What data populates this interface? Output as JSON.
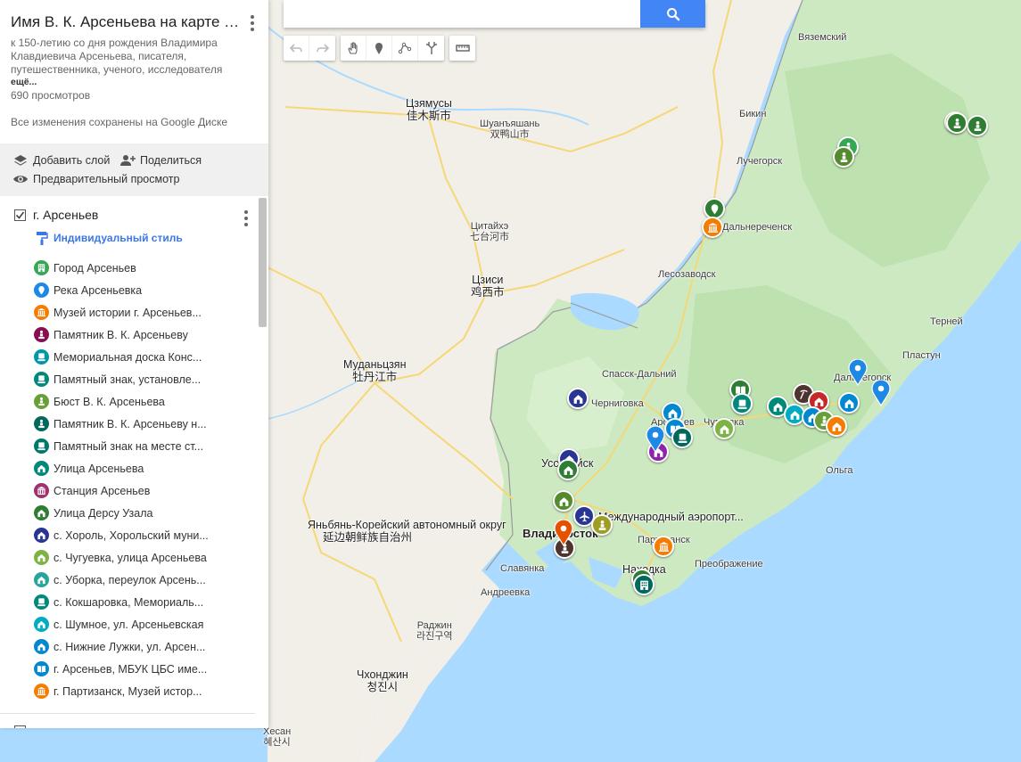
{
  "panel": {
    "title": "Имя В. К. Арсеньева на карте П...",
    "description": "к 150-летию со дня рождения Владимира Клавдиевича Арсеньева, писателя, путешественника, ученого, исследователя",
    "more": "ещё...",
    "views": "690 просмотров",
    "saved": "Все изменения сохранены на Google Диске",
    "actions": {
      "add_layer": "Добавить слой",
      "share": "Поделиться",
      "preview": "Предварительный просмотр"
    },
    "layer": {
      "name": "г. Арсеньев",
      "style": "Индивидуальный стиль",
      "items": [
        {
          "label": "Город Арсеньев",
          "color": "#34a853",
          "icon": "building-icon"
        },
        {
          "label": "Река Арсеньевка",
          "color": "#1e88e5",
          "icon": "map-pin-icon"
        },
        {
          "label": "Музей истории г. Арсеньев...",
          "color": "#f57c00",
          "icon": "museum-icon"
        },
        {
          "label": "Памятник В. К. Арсеньеву",
          "color": "#880e4f",
          "icon": "monument-icon"
        },
        {
          "label": "Мемориальная доска Конс...",
          "color": "#0097a7",
          "icon": "plaque-icon"
        },
        {
          "label": "Памятный знак, установле...",
          "color": "#00897b",
          "icon": "plaque-icon"
        },
        {
          "label": "Бюст В. К. Арсеньева",
          "color": "#689f38",
          "icon": "monument-icon"
        },
        {
          "label": "Памятник В. К. Арсеньеву н...",
          "color": "#00695c",
          "icon": "monument-icon"
        },
        {
          "label": "Памятный знак на месте ст...",
          "color": "#00796b",
          "icon": "plaque-icon"
        },
        {
          "label": "Улица Арсеньева",
          "color": "#00897b",
          "icon": "street-icon"
        },
        {
          "label": "Станция Арсеньев",
          "color": "#a0306e",
          "icon": "station-icon"
        },
        {
          "label": "Улица Дерсу Узала",
          "color": "#2e7d32",
          "icon": "street-icon"
        },
        {
          "label": "с. Хороль, Хорольский муни...",
          "color": "#283593",
          "icon": "street-icon"
        },
        {
          "label": "с. Чугуевка, улица Арсеньева",
          "color": "#7cb342",
          "icon": "street-icon"
        },
        {
          "label": "с. Уборка, переулок Арсень...",
          "color": "#26a69a",
          "icon": "street-icon"
        },
        {
          "label": "с. Кокшаровка, Мемориаль...",
          "color": "#00897b",
          "icon": "plaque-icon"
        },
        {
          "label": "с. Шумное, ул. Арсеньевская",
          "color": "#00acc1",
          "icon": "street-icon"
        },
        {
          "label": "с. Нижние Лужки, ул. Арсен...",
          "color": "#0288d1",
          "icon": "street-icon"
        },
        {
          "label": "г. Арсеньев, МБУК ЦБС име...",
          "color": "#0288d1",
          "icon": "book-icon"
        },
        {
          "label": "г. Партизанск, Музей истор...",
          "color": "#f57c00",
          "icon": "museum-icon"
        }
      ]
    }
  },
  "search": {
    "placeholder": ""
  },
  "map": {
    "places": {
      "jiamusi_ru": "Цзямусы",
      "jiamusi_cn": "佳木斯市",
      "shuangyashan_ru": "Шуанъяшань",
      "shuangyashan_cn": "双鸭山市",
      "qitaihe_ru": "Цитайхэ",
      "qitaihe_cn": "七台河市",
      "jixi_ru": "Цзиси",
      "jixi_cn": "鸡西市",
      "mudanjiang_ru": "Муданьцзян",
      "mudanjiang_cn": "牡丹江市",
      "yanbian_ru": "Яньбянь-Корейский автономный округ",
      "yanbian_cn": "延边朝鲜族自治州",
      "chongjin_ru": "Чхонджин",
      "chongjin_ko": "청진시",
      "rajin_ru": "Раджин",
      "rajin_ko": "라진구역",
      "hesan_ru": "Хесан",
      "hesan_ko": "혜산시",
      "vyazemsky": "Вяземский",
      "bikin": "Бикин",
      "luchegorsk": "Лучегорск",
      "dalnerechensk": "Дальнереченск",
      "lesozavodsk": "Лесозаводск",
      "spassk": "Спасск-Дальний",
      "chernigovka": "Черниговка",
      "arsenyev": "Арсеньев",
      "chuguevka": "Чугуевка",
      "dalnegorsk": "Дальнегорск",
      "terney": "Терней",
      "plastun": "Пластун",
      "olga": "Ольга",
      "ussuriysk": "Уссурийск",
      "vladivostok": "Владивосток",
      "airport": "Международный аэропорт...",
      "partizansk": "Партизанск",
      "nakhodka": "Находка",
      "preobrazhenie": "Преображение",
      "slavyanka": "Славянка",
      "andreevka": "Андреевка",
      "dalnerechensk_label": "Дальнереченск"
    }
  }
}
